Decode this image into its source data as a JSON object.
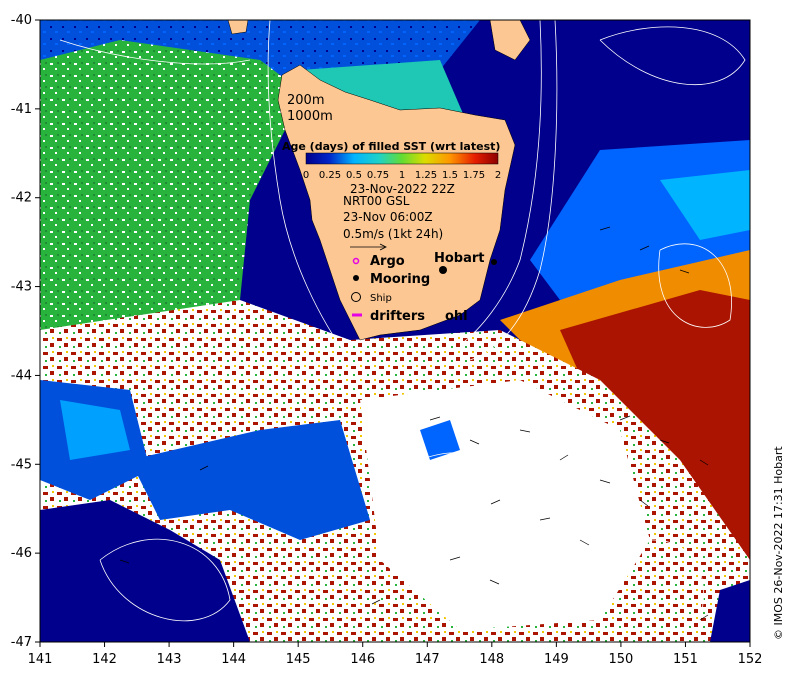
{
  "map": {
    "x_ticks": [
      "141",
      "142",
      "143",
      "144",
      "145",
      "146",
      "147",
      "148",
      "149",
      "150",
      "151",
      "152"
    ],
    "y_ticks": [
      "-40",
      "-41",
      "-42",
      "-43",
      "-44",
      "-45",
      "-46",
      "-47"
    ],
    "lon_range": [
      141,
      152
    ],
    "lat_range": [
      -47,
      -40
    ]
  },
  "depth_contours": {
    "line1": "200m",
    "line2": "1000m"
  },
  "colorbar": {
    "title": "Age (days) of filled SST (wrt latest)",
    "tick_labels": [
      "0",
      "0.25",
      "0.5",
      "0.75",
      "1",
      "1.25",
      "1.5",
      "1.75",
      "2"
    ],
    "colors": [
      "#00008c",
      "#0024c8",
      "#0064ff",
      "#00b4ff",
      "#1ed2c8",
      "#32c864",
      "#64dc32",
      "#a0e61e",
      "#dcdc00",
      "#ffb400",
      "#ff6400",
      "#e61e00",
      "#b40000",
      "#8c0000"
    ]
  },
  "info": {
    "sst_time": "23-Nov-2022 22Z",
    "current_source": "NRT00 GSL",
    "current_time": "23-Nov 06:00Z",
    "scale_label": "0.5m/s (1kt 24h)"
  },
  "legend": {
    "argo": "Argo",
    "mooring": "Mooring",
    "ship": "Ship",
    "drifters": "drifters",
    "other": "ohl"
  },
  "places": {
    "hobart": "Hobart"
  },
  "credit": "© IMOS 26-Nov-2022 17:31 Hobart",
  "colors": {
    "land": "#fcc792",
    "deep_blue": "#00008c",
    "mid_blue": "#0050dc",
    "green": "#28b43c",
    "dark_red": "#aa1400",
    "orange": "#f08c00"
  }
}
